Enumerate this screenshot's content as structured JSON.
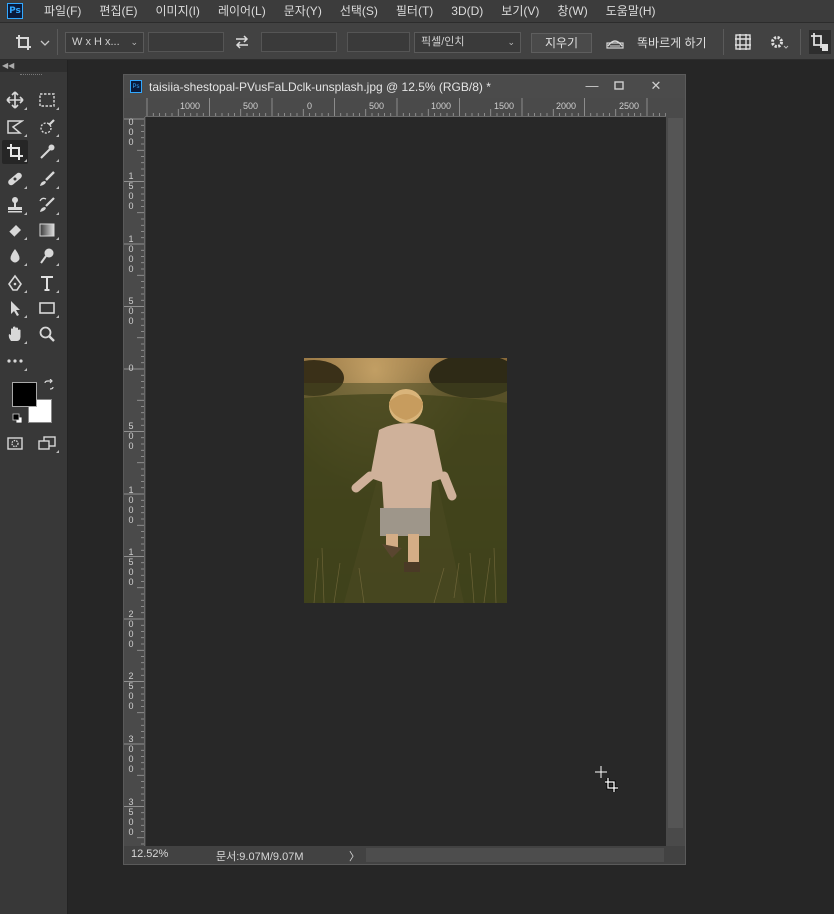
{
  "app": {
    "logo": "Ps"
  },
  "menu": [
    "파일(F)",
    "편집(E)",
    "이미지(I)",
    "레이어(L)",
    "문자(Y)",
    "선택(S)",
    "필터(T)",
    "3D(D)",
    "보기(V)",
    "창(W)",
    "도움말(H)"
  ],
  "options": {
    "ratio_preset": "W x H x...",
    "unit": "픽셀/인치",
    "clear_label": "지우기",
    "straighten_label": "똑바르게 하기"
  },
  "document": {
    "tab_icon": "Ps",
    "title": "taisiia-shestopal-PVusFaLDclk-unsplash.jpg @ 12.5% (RGB/8) *",
    "ruler_top": [
      "1000",
      "500",
      "0",
      "500",
      "1000",
      "1500",
      "2000",
      "2500"
    ],
    "ruler_left": [
      "0\n0\n0",
      "1\n5\n0\n0",
      "1\n0\n0\n0",
      "5\n0\n0",
      "0",
      "5\n0\n0",
      "1\n0\n0\n0",
      "1\n5\n0\n0",
      "2\n0\n0\n0",
      "2\n5\n0\n0",
      "3\n0\n0\n0",
      "3\n5\n0\n0"
    ],
    "zoom": "12.52%",
    "doc_size": "문서:9.07M/9.07M",
    "status_arrow": "〉"
  },
  "colors": {
    "foreground": "#000000",
    "background": "#ffffff",
    "accent": "#31a8ff"
  },
  "icons": {
    "tools": [
      "move-icon",
      "marquee-icon",
      "lasso-icon",
      "quick-select-icon",
      "crop-icon",
      "eyedropper-icon",
      "healing-icon",
      "brush-icon",
      "stamp-icon",
      "history-brush-icon",
      "eraser-icon",
      "gradient-icon",
      "blur-icon",
      "dodge-icon",
      "pen-icon",
      "type-icon",
      "path-select-icon",
      "rectangle-icon",
      "hand-icon",
      "zoom-icon",
      "more-tools-icon"
    ]
  }
}
